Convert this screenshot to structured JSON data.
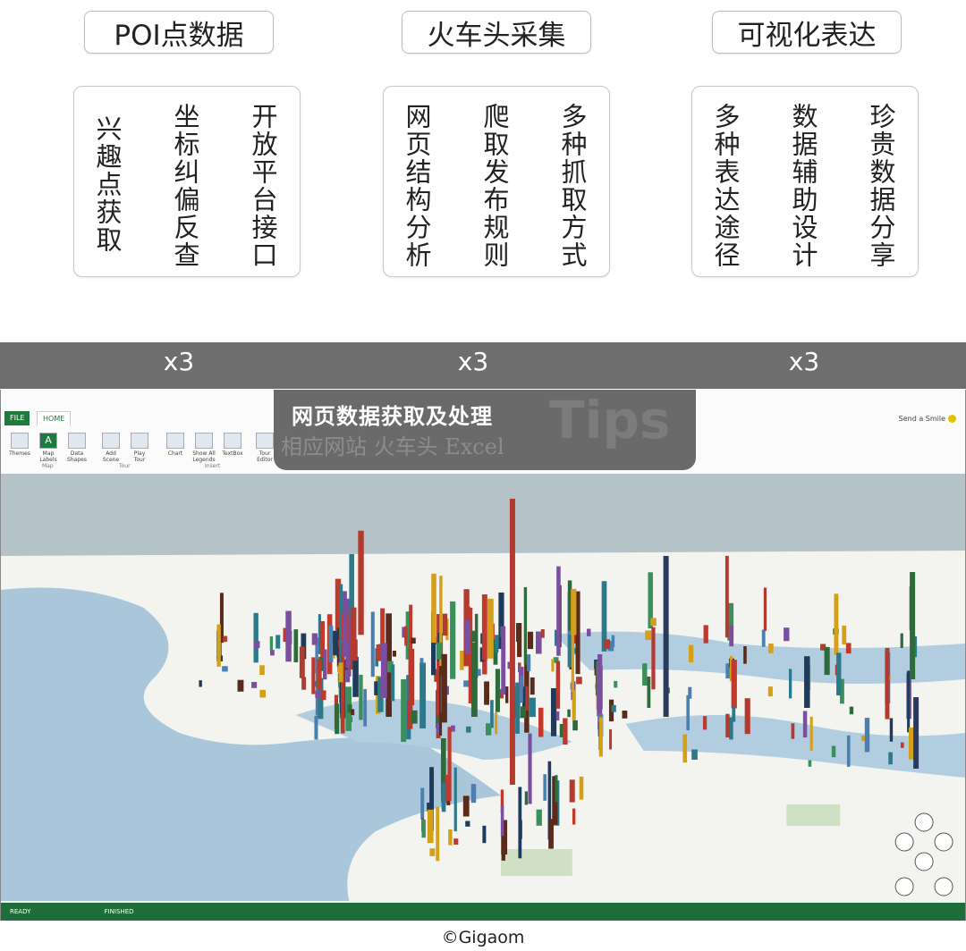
{
  "sections": [
    {
      "title": "POI点数据",
      "items": [
        "兴趣点获取",
        "坐标纠偏反查",
        "开放平台接口"
      ]
    },
    {
      "title": "火车头采集",
      "items": [
        "网页结构分析",
        "爬取发布规则",
        "多种抓取方式"
      ]
    },
    {
      "title": "可视化表达",
      "items": [
        "多种表达途径",
        "数据辅助设计",
        "珍贵数据分享"
      ]
    }
  ],
  "band": {
    "labels": [
      "x3",
      "x3",
      "x3"
    ]
  },
  "tips": {
    "title": "网页数据获取及处理",
    "subtitle": "相应网站 火车头 Excel",
    "watermark": "Tips"
  },
  "app": {
    "tabs": [
      "FILE",
      "HOME"
    ],
    "ribbon_buttons": [
      "Themes",
      "Map Labels",
      "Data Shapes",
      "Add Scene",
      "Play Tour",
      "Chart",
      "Show All Legends",
      "TextBox",
      "Tour Editor"
    ],
    "ribbon_groups": [
      "Map",
      "Tour",
      "Insert"
    ],
    "feedback": "Send a Smile",
    "status_left": "READY",
    "status_mid": "FINISHED"
  },
  "credit": "©Gigaom",
  "colors": {
    "band": "#6e6e6e",
    "water": "#aac8dd",
    "land": "#f4f4f2",
    "status_bar": "#1f6d3a"
  }
}
